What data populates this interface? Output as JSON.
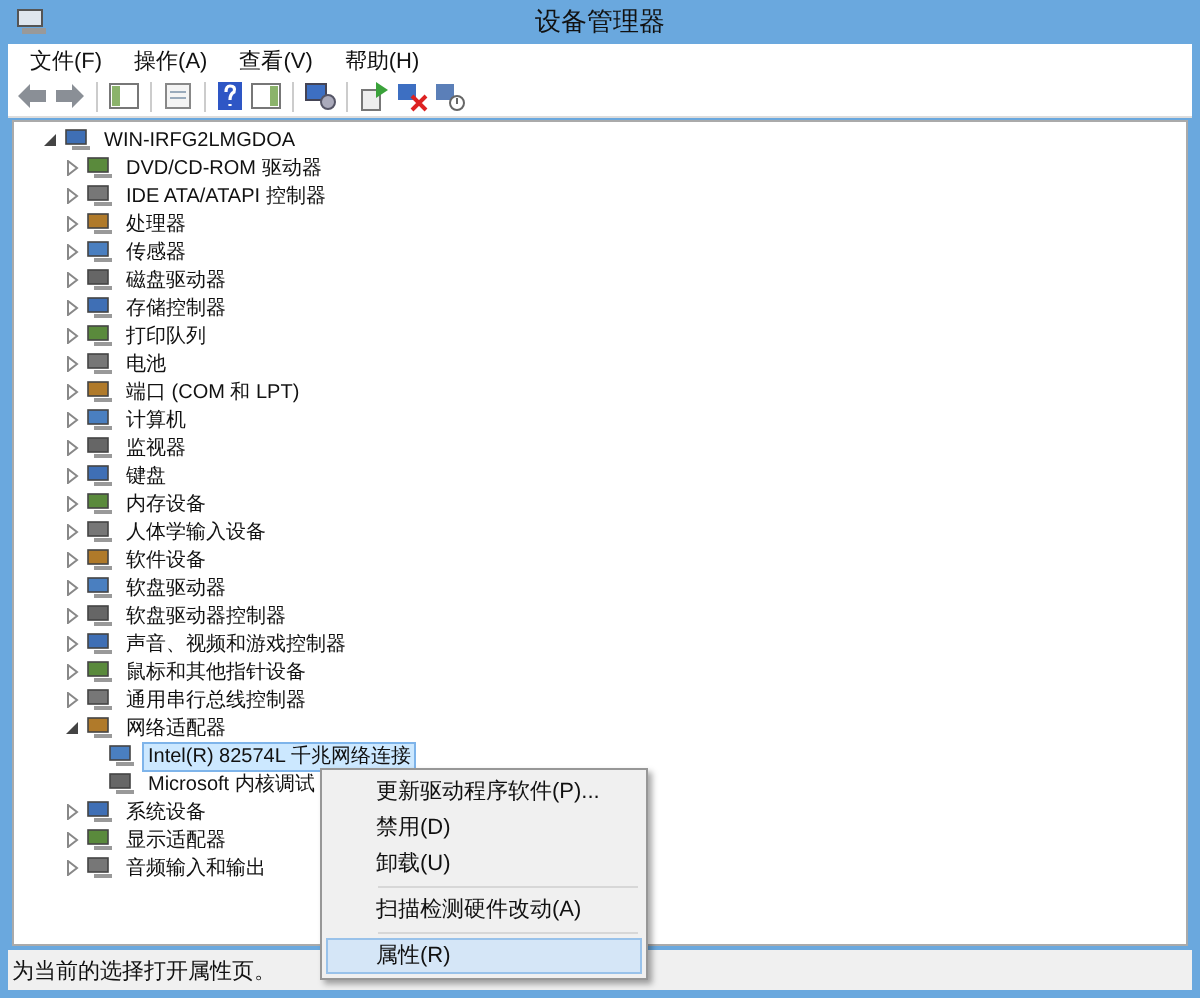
{
  "window": {
    "title": "设备管理器"
  },
  "menu": [
    {
      "label": "文件(F)"
    },
    {
      "label": "操作(A)"
    },
    {
      "label": "查看(V)"
    },
    {
      "label": "帮助(H)"
    }
  ],
  "tree": {
    "label": "WIN-IRFG2LMGDOA",
    "expanded": true,
    "selected": false,
    "children": [
      {
        "label": "DVD/CD-ROM 驱动器",
        "expanded": false,
        "selected": false
      },
      {
        "label": "IDE ATA/ATAPI 控制器",
        "expanded": false,
        "selected": false
      },
      {
        "label": "处理器",
        "expanded": false,
        "selected": false
      },
      {
        "label": "传感器",
        "expanded": false,
        "selected": false
      },
      {
        "label": "磁盘驱动器",
        "expanded": false,
        "selected": false
      },
      {
        "label": "存储控制器",
        "expanded": false,
        "selected": false
      },
      {
        "label": "打印队列",
        "expanded": false,
        "selected": false
      },
      {
        "label": "电池",
        "expanded": false,
        "selected": false
      },
      {
        "label": "端口 (COM 和 LPT)",
        "expanded": false,
        "selected": false
      },
      {
        "label": "计算机",
        "expanded": false,
        "selected": false
      },
      {
        "label": "监视器",
        "expanded": false,
        "selected": false
      },
      {
        "label": "键盘",
        "expanded": false,
        "selected": false
      },
      {
        "label": "内存设备",
        "expanded": false,
        "selected": false
      },
      {
        "label": "人体学输入设备",
        "expanded": false,
        "selected": false
      },
      {
        "label": "软件设备",
        "expanded": false,
        "selected": false
      },
      {
        "label": "软盘驱动器",
        "expanded": false,
        "selected": false
      },
      {
        "label": "软盘驱动器控制器",
        "expanded": false,
        "selected": false
      },
      {
        "label": "声音、视频和游戏控制器",
        "expanded": false,
        "selected": false
      },
      {
        "label": "鼠标和其他指针设备",
        "expanded": false,
        "selected": false
      },
      {
        "label": "通用串行总线控制器",
        "expanded": false,
        "selected": false
      },
      {
        "label": "网络适配器",
        "expanded": true,
        "selected": false,
        "children": [
          {
            "label": "Intel(R) 82574L 千兆网络连接",
            "selected": true
          },
          {
            "label": "Microsoft 内核调试",
            "selected": false
          }
        ]
      },
      {
        "label": "系统设备",
        "expanded": false,
        "selected": false
      },
      {
        "label": "显示适配器",
        "expanded": false,
        "selected": false
      },
      {
        "label": "音频输入和输出",
        "expanded": false,
        "selected": false
      }
    ]
  },
  "context_menu": {
    "items": [
      {
        "kind": "item",
        "label": "更新驱动程序软件(P)...",
        "selected": false
      },
      {
        "kind": "item",
        "label": "禁用(D)",
        "selected": false
      },
      {
        "kind": "item",
        "label": "卸载(U)",
        "selected": false
      },
      {
        "kind": "separator"
      },
      {
        "kind": "item",
        "label": "扫描检测硬件改动(A)",
        "selected": false
      },
      {
        "kind": "separator"
      },
      {
        "kind": "item",
        "label": "属性(R)",
        "selected": true
      }
    ]
  },
  "status_bar": {
    "text": "为当前的选择打开属性页。"
  }
}
